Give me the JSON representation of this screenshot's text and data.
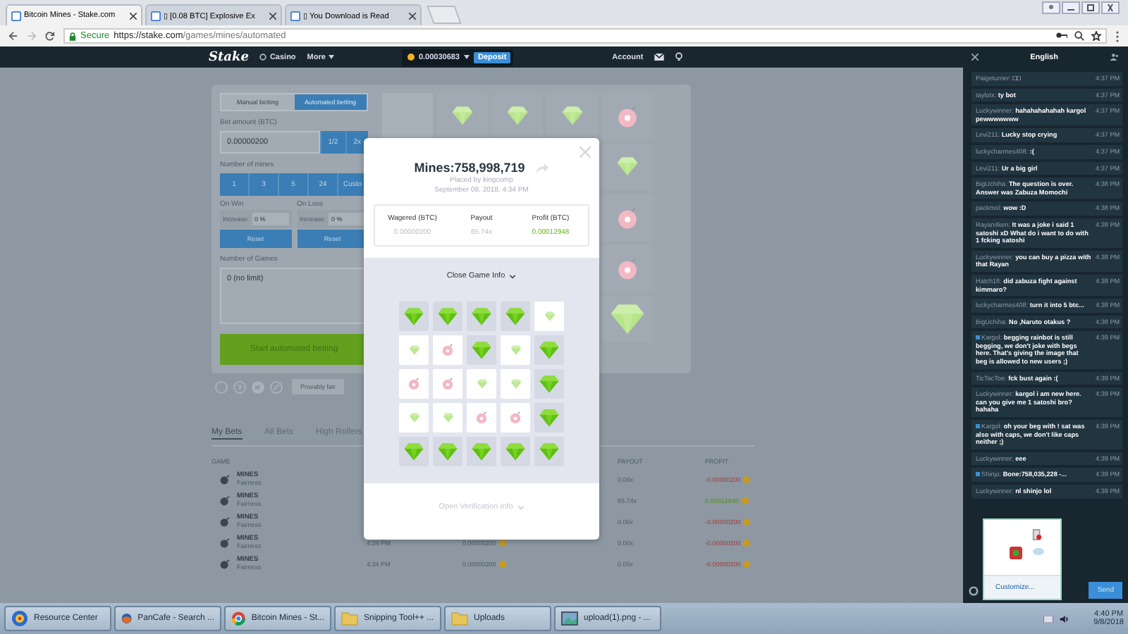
{
  "browser": {
    "tabs": [
      {
        "title": "Bitcoin Mines - Stake.com",
        "selected": true
      },
      {
        "title": "▯ [0.08 BTC] Explosive Ex",
        "selected": false
      },
      {
        "title": "▯ You Download is Read",
        "selected": false
      }
    ],
    "security": "Secure",
    "url_host": "https://stake.com",
    "url_path": "/games/mines/automated"
  },
  "site_header": {
    "logo": "Stake",
    "nav": [
      "Casino",
      "More"
    ],
    "balance": "0.00030683",
    "deposit": "Deposit",
    "account": "Account"
  },
  "bet_panel": {
    "modes": [
      {
        "label": "Manual betting",
        "selected": false
      },
      {
        "label": "Automated betting",
        "selected": true
      }
    ],
    "bet_amount_label": "Bet amount (BTC)",
    "bet_amount": "0.00000200",
    "bet_buttons": [
      "1/2",
      "2x"
    ],
    "mines_label": "Number of mines",
    "mines_options": [
      "1",
      "3",
      "5",
      "24",
      "Custo"
    ],
    "on_win": {
      "label": "On Win",
      "field_label": "Increase:",
      "value": "0 %",
      "reset": "Reset"
    },
    "on_loss": {
      "label": "On Loss",
      "field_label": "Increase:",
      "value": "0 %",
      "reset": "Reset"
    },
    "games_label": "Number of Games",
    "games_value": "0 (no limit)",
    "start": "Start automated betting",
    "provably_fair": "Provably fair"
  },
  "board": {
    "top_row": [
      {
        "kind": "unrevealed"
      },
      {
        "kind": "gem"
      },
      {
        "kind": "gem"
      },
      {
        "kind": "gem"
      },
      {
        "kind": "mine"
      }
    ],
    "right_column": [
      {
        "kind": "gem"
      },
      {
        "kind": "mine"
      },
      {
        "kind": "mine"
      },
      {
        "kind": "gem"
      }
    ]
  },
  "bets": {
    "tabs": [
      {
        "label": "My Bets",
        "selected": true
      },
      {
        "label": "All Bets",
        "selected": false
      },
      {
        "label": "High Rollers",
        "selected": false
      }
    ],
    "columns": [
      "GAME",
      "PAYOUT",
      "PROFIT"
    ],
    "rows": [
      {
        "game": "MINES",
        "link": "Fairness",
        "payout": "0.00x",
        "profit": "-0.00000200",
        "win": false
      },
      {
        "game": "MINES",
        "link": "Fairness",
        "payout": "65.74x",
        "profit": "0.00012948",
        "win": true
      },
      {
        "game": "MINES",
        "link": "Fairness",
        "payout": "0.00x",
        "profit": "-0.00000200",
        "win": false
      },
      {
        "game": "MINES",
        "link": "Fairness",
        "time": "4:34 PM",
        "bet": "0.00000200",
        "payout": "0.00x",
        "profit": "-0.00000200",
        "win": false
      },
      {
        "game": "MINES",
        "link": "Fairness",
        "time": "4:34 PM",
        "bet": "0.00000200",
        "payout": "0.00x",
        "profit": "-0.00000200",
        "win": false
      }
    ]
  },
  "modal": {
    "title": "Mines:758,998,719",
    "placed_by": "Placed by kingcomp",
    "date": "September 08, 2018, 4:34 PM",
    "stats": [
      {
        "label": "Wagered (BTC)",
        "value": "0.00000200",
        "kind": "plain"
      },
      {
        "label": "Payout",
        "value": "65.74x",
        "kind": "plain"
      },
      {
        "label": "Profit (BTC)",
        "value": "0.00012948",
        "kind": "positive"
      }
    ],
    "close_info": "Close Game Info",
    "grid": [
      [
        {
          "kind": "gem",
          "picked": true
        },
        {
          "kind": "gem",
          "picked": true
        },
        {
          "kind": "gem",
          "picked": true
        },
        {
          "kind": "gem",
          "picked": true
        },
        {
          "kind": "gem",
          "picked": false
        }
      ],
      [
        {
          "kind": "gem",
          "picked": false
        },
        {
          "kind": "mine",
          "picked": false
        },
        {
          "kind": "gem",
          "picked": true
        },
        {
          "kind": "gem",
          "picked": false
        },
        {
          "kind": "gem",
          "picked": true
        }
      ],
      [
        {
          "kind": "mine",
          "picked": false
        },
        {
          "kind": "mine",
          "picked": false
        },
        {
          "kind": "gem",
          "picked": false
        },
        {
          "kind": "gem",
          "picked": false
        },
        {
          "kind": "gem",
          "picked": true
        }
      ],
      [
        {
          "kind": "gem",
          "picked": false
        },
        {
          "kind": "gem",
          "picked": false
        },
        {
          "kind": "mine",
          "picked": false
        },
        {
          "kind": "mine",
          "picked": false
        },
        {
          "kind": "gem",
          "picked": true
        }
      ],
      [
        {
          "kind": "gem",
          "picked": true
        },
        {
          "kind": "gem",
          "picked": true
        },
        {
          "kind": "gem",
          "picked": true
        },
        {
          "kind": "gem",
          "picked": true
        },
        {
          "kind": "gem",
          "picked": true
        }
      ]
    ],
    "verification": "Open Verification Info"
  },
  "chat": {
    "language": "English",
    "send": "Send",
    "messages": [
      {
        "user": "Paigeturner:",
        "text": "□□",
        "time": "4:37 PM",
        "badge": false
      },
      {
        "user": "taylotx:",
        "text": "ty bot",
        "time": "4:37 PM",
        "badge": false
      },
      {
        "user": "Luckywinner:",
        "text": "hahahahahahah kargol pewwwwwww",
        "time": "4:37 PM",
        "badge": false
      },
      {
        "user": "Levi211:",
        "text": "Lucky stop crying",
        "time": "4:37 PM",
        "badge": false
      },
      {
        "user": "luckycharmes408:",
        "text": ":(",
        "time": "4:37 PM",
        "badge": false
      },
      {
        "user": "Levi211:",
        "text": "Ur a big girl",
        "time": "4:37 PM",
        "badge": false
      },
      {
        "user": "BigUchiha:",
        "text": "The question is over. Answer was Zabuza Momochi",
        "time": "4:38 PM",
        "badge": false
      },
      {
        "user": "packmol:",
        "text": "wow :D",
        "time": "4:38 PM",
        "badge": false
      },
      {
        "user": "Rayan4ken:",
        "text": "It was a joke i said 1 satoshi xD What do i want to do with 1 fcking satoshi",
        "time": "4:38 PM",
        "badge": false
      },
      {
        "user": "Luckywinner:",
        "text": "you can buy a pizza with that Rayan",
        "time": "4:38 PM",
        "badge": false
      },
      {
        "user": "Hatch18:",
        "text": "did zabuza fight against kimmaro?",
        "time": "4:38 PM",
        "badge": false
      },
      {
        "user": "luckycharmes408:",
        "text": "turn it into 5 btc...",
        "time": "4:38 PM",
        "badge": false
      },
      {
        "user": "BigUchiha:",
        "text": "No ,Naruto otakus ?",
        "time": "4:38 PM",
        "badge": false
      },
      {
        "user": "Kargol:",
        "text": "begging rainbot is still begging, we don't joke with begs here. That's giving the image that beg is allowed to new users ;)",
        "time": "4:39 PM",
        "badge": true
      },
      {
        "user": "TicTacToe:",
        "text": "fck bust again :(",
        "time": "4:39 PM",
        "badge": false
      },
      {
        "user": "Luckywinner:",
        "text": "kargol i am new here. can you give me 1 satoshi bro? hahaha",
        "time": "4:39 PM",
        "badge": false
      },
      {
        "user": "Kargol:",
        "text": "oh your beg with ! sat was also with caps, we don't like caps neither ;)",
        "time": "4:39 PM",
        "badge": true
      },
      {
        "user": "Luckywinner:",
        "text": "eee",
        "time": "4:39 PM",
        "badge": false
      },
      {
        "user": "Shinjo:",
        "text": "Bone:758,035,228 -...",
        "time": "4:39 PM",
        "badge": true
      },
      {
        "user": "Luckywinner:",
        "text": "nl shinjo lol",
        "time": "4:39 PM",
        "badge": false
      }
    ]
  },
  "tray_popup": {
    "customize": "Customize..."
  },
  "taskbar": {
    "items": [
      {
        "label": "Resource Center",
        "kind": "globe"
      },
      {
        "label": "PanCafe - Search ...",
        "kind": "browser"
      },
      {
        "label": "Bitcoin Mines - St...",
        "kind": "chrome"
      },
      {
        "label": "Snipping Tool++ ...",
        "kind": "folder"
      },
      {
        "label": "Uploads",
        "kind": "folder"
      },
      {
        "label": "upload(1).png - ...",
        "kind": "image"
      }
    ],
    "time": "4:40 PM",
    "date": "9/8/2018"
  }
}
